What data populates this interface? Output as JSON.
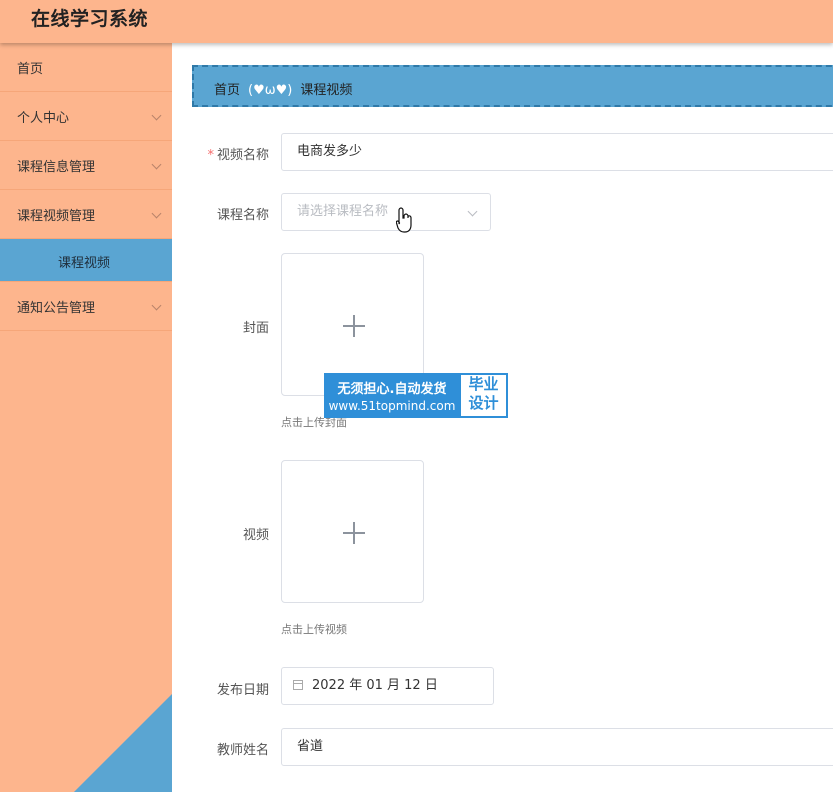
{
  "header": {
    "title": "在线学习系统"
  },
  "sidebar": {
    "items": [
      {
        "label": "首页",
        "has_children": false
      },
      {
        "label": "个人中心",
        "has_children": true
      },
      {
        "label": "课程信息管理",
        "has_children": true
      },
      {
        "label": "课程视频管理",
        "has_children": true,
        "expanded": true
      },
      {
        "label": "通知公告管理",
        "has_children": true
      }
    ],
    "active_sub": {
      "label": "课程视频"
    }
  },
  "breadcrumb": {
    "home": "首页",
    "emote": "(♥ω♥)",
    "current": "课程视频"
  },
  "form": {
    "video_name": {
      "label": "视频名称",
      "required": true,
      "value": "电商发多少"
    },
    "course_name": {
      "label": "课程名称",
      "placeholder": "请选择课程名称"
    },
    "cover": {
      "label": "封面",
      "hint": "点击上传封面"
    },
    "video": {
      "label": "视频",
      "hint": "点击上传视频"
    },
    "publish_date": {
      "label": "发布日期",
      "value": "2022 年 01 月 12 日"
    },
    "teacher_name": {
      "label": "教师姓名",
      "value": "省道"
    }
  },
  "watermark": {
    "line1": "无须担心.自动发货",
    "line2": "www.51topmind.com",
    "side_top": "毕业",
    "side_bottom": "设计"
  },
  "colors": {
    "header_bg": "#fdb58d",
    "accent_blue": "#5aa5d2",
    "required": "#f56c6c"
  }
}
